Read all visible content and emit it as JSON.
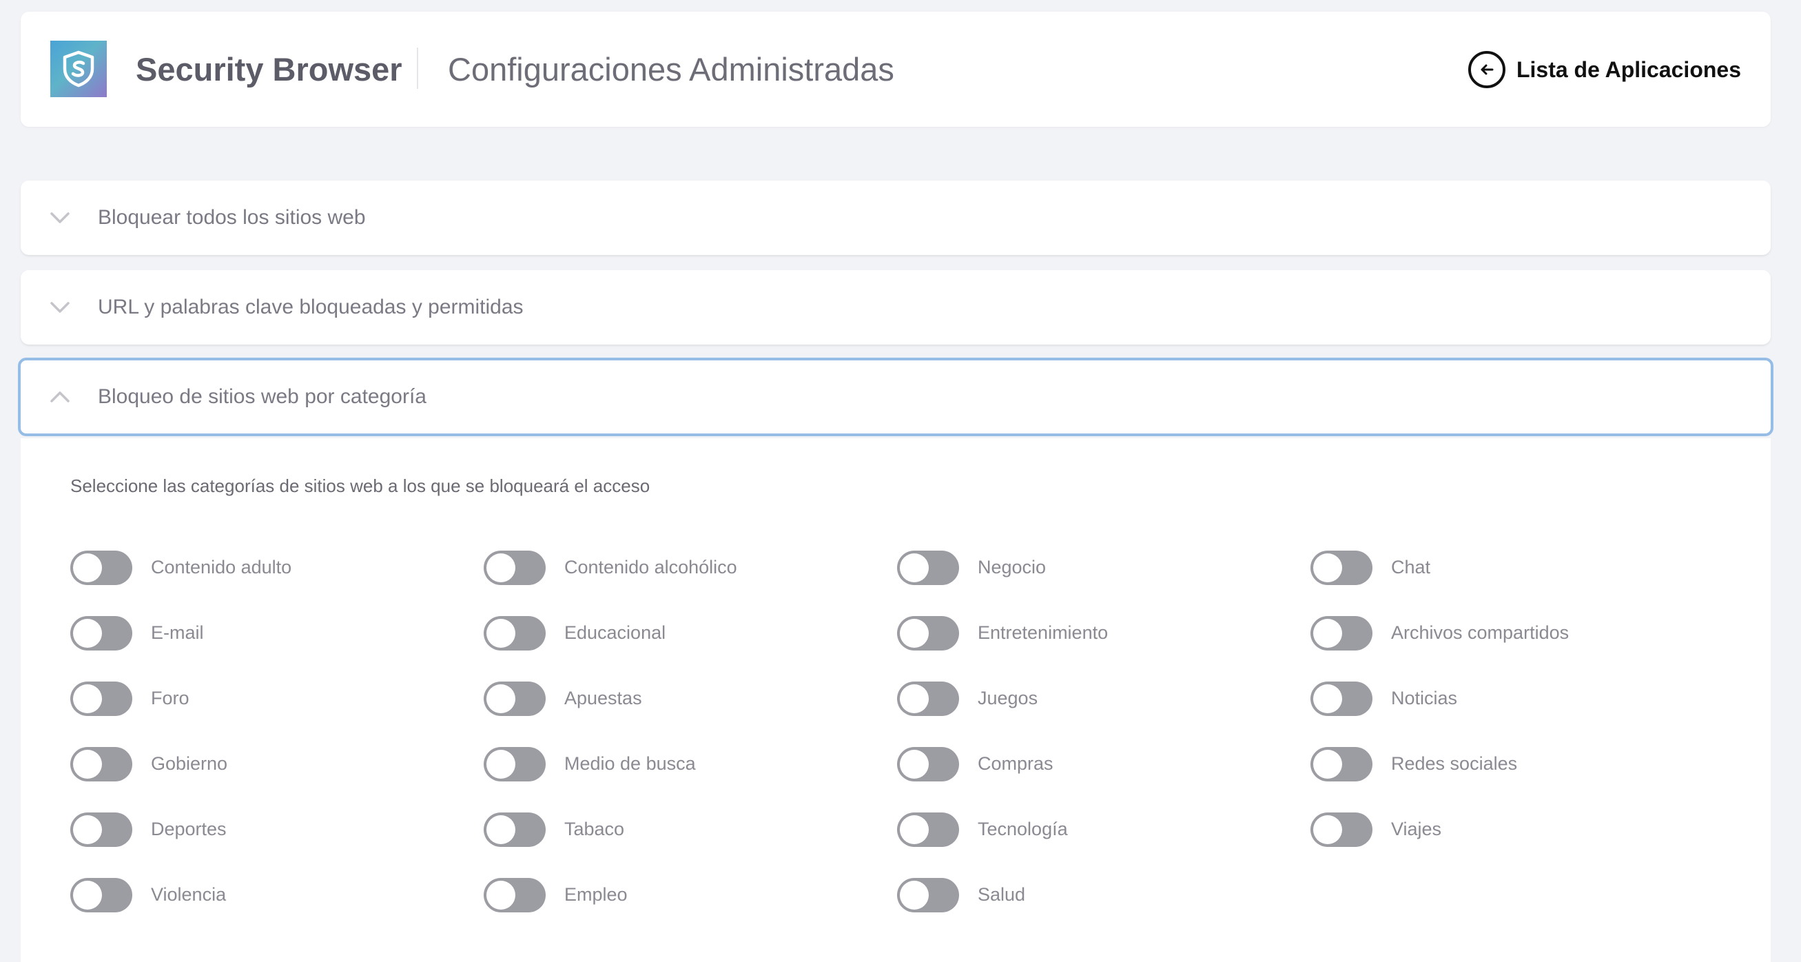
{
  "header": {
    "app_name": "Security Browser",
    "page_title": "Configuraciones Administradas",
    "back_label": "Lista de Aplicaciones",
    "logo_icon": "shield-s-icon",
    "back_icon": "arrow-left-circle-icon"
  },
  "panels": [
    {
      "title": "Bloquear todos los sitios web",
      "expanded": false
    },
    {
      "title": "URL y palabras clave bloqueadas y permitidas",
      "expanded": false
    },
    {
      "title": "Bloqueo de sitios web por categoría",
      "expanded": true
    }
  ],
  "category_section": {
    "instruction": "Seleccione las categorías de sitios web a los que se bloqueará el acceso",
    "categories": [
      {
        "label": "Contenido adulto",
        "enabled": false
      },
      {
        "label": "Contenido alcohólico",
        "enabled": false
      },
      {
        "label": "Negocio",
        "enabled": false
      },
      {
        "label": "Chat",
        "enabled": false
      },
      {
        "label": "E-mail",
        "enabled": false
      },
      {
        "label": "Educacional",
        "enabled": false
      },
      {
        "label": "Entretenimiento",
        "enabled": false
      },
      {
        "label": "Archivos compartidos",
        "enabled": false
      },
      {
        "label": "Foro",
        "enabled": false
      },
      {
        "label": "Apuestas",
        "enabled": false
      },
      {
        "label": "Juegos",
        "enabled": false
      },
      {
        "label": "Noticias",
        "enabled": false
      },
      {
        "label": "Gobierno",
        "enabled": false
      },
      {
        "label": "Medio de busca",
        "enabled": false
      },
      {
        "label": "Compras",
        "enabled": false
      },
      {
        "label": "Redes sociales",
        "enabled": false
      },
      {
        "label": "Deportes",
        "enabled": false
      },
      {
        "label": "Tabaco",
        "enabled": false
      },
      {
        "label": "Tecnología",
        "enabled": false
      },
      {
        "label": "Viajes",
        "enabled": false
      },
      {
        "label": "Violencia",
        "enabled": false
      },
      {
        "label": "Empleo",
        "enabled": false
      },
      {
        "label": "Salud",
        "enabled": false
      }
    ]
  },
  "colors": {
    "background": "#f2f3f7",
    "active_border": "#95bde6",
    "toggle_off": "#9c9ca3"
  }
}
